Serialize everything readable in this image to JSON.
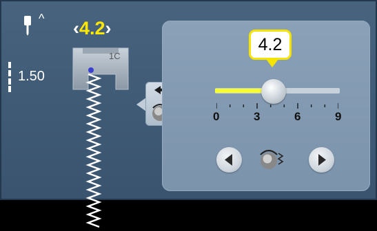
{
  "header": {
    "caret": "^",
    "width_left_bracket": "‹",
    "width_value": "4.2",
    "width_right_bracket": "›"
  },
  "left": {
    "length_value": "1.50",
    "presser_foot_label": "1C"
  },
  "slider": {
    "bubble_value": "4.2",
    "value": 4.2,
    "min": 0,
    "max": 9,
    "tick_labels": [
      "0",
      "3",
      "6",
      "9"
    ],
    "fill_color": "#f5ff2a",
    "bubble_border_color": "#f5e400"
  },
  "icons": {
    "needle": "needle-icon",
    "rotate": "rotate-arrow-icon",
    "stitch_dial": "stitch-width-dial-icon",
    "left_arrow": "arrow-left-icon",
    "right_arrow": "arrow-right-icon"
  },
  "colors": {
    "accent_yellow": "#ffe800",
    "screen_bg": "#45607b",
    "panel_bg": "#8299b0"
  }
}
